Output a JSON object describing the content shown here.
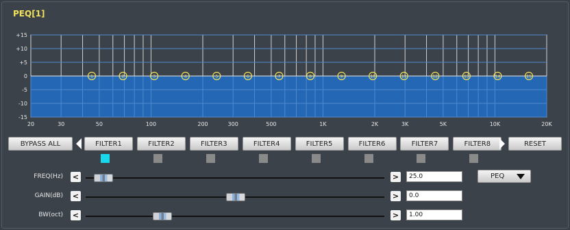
{
  "title": "PEQ[1]",
  "graph": {
    "y_labels": [
      "+15",
      "+10",
      "+5",
      "0",
      "-5",
      "-10",
      "-15"
    ],
    "x_labels": [
      "20",
      "30",
      "50",
      "100",
      "200",
      "300",
      "500",
      "1K",
      "2K",
      "3K",
      "5K",
      "10K",
      "20K"
    ],
    "fill_color": "#2467b4",
    "filter_markers": [
      "1",
      "2",
      "3",
      "4",
      "5",
      "6",
      "7",
      "8",
      "9",
      "10",
      "11",
      "12",
      "13",
      "14",
      "15"
    ]
  },
  "toolbar": {
    "bypass_label": "BYPASS ALL",
    "reset_label": "RESET",
    "filters": [
      "FILTER1",
      "FILTER2",
      "FILTER3",
      "FILTER4",
      "FILTER5",
      "FILTER6",
      "FILTER7",
      "FILTER8"
    ],
    "selected_filter_index": 0
  },
  "controls": {
    "freq": {
      "label": "FREQ(Hz)",
      "value": "25.0",
      "slider_fraction": 0.03
    },
    "gain": {
      "label": "GAIN(dB)",
      "value": "0.0",
      "slider_fraction": 0.5
    },
    "bw": {
      "label": "BW(oct)",
      "value": "1.00",
      "slider_fraction": 0.24
    }
  },
  "type_dropdown": {
    "value": "PEQ"
  },
  "colors": {
    "title": "#f2e25a",
    "selected_indicator": "#19d8ee",
    "indicator": "#8a8a8a",
    "marker": "#f2e25a"
  }
}
